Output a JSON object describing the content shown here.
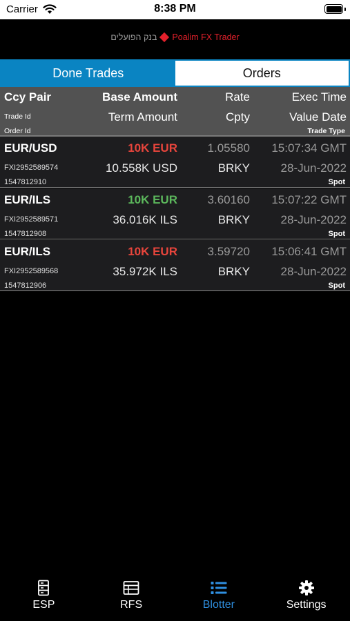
{
  "status_bar": {
    "carrier": "Carrier",
    "time": "8:38 PM"
  },
  "brand": {
    "hebrew_name": "בנק הפועלים",
    "app_name": "Poalim FX Trader",
    "accent_color": "#e3202b"
  },
  "tabs": {
    "done_trades": "Done Trades",
    "orders": "Orders",
    "active": "done_trades",
    "active_color": "#0a84c2"
  },
  "columns": {
    "row1": {
      "ccy_pair": "Ccy Pair",
      "base_amount": "Base Amount",
      "rate": "Rate",
      "exec_time": "Exec Time"
    },
    "row2": {
      "trade_id": "Trade Id",
      "term_amount": "Term Amount",
      "cpty": "Cpty",
      "value_date": "Value Date"
    },
    "row3": {
      "order_id": "Order Id",
      "trade_type": "Trade Type"
    }
  },
  "trades": [
    {
      "ccy_pair": "EUR/USD",
      "base_amount": "10K EUR",
      "direction": "sell",
      "rate": "1.05580",
      "exec_time": "15:07:34 GMT",
      "trade_id": "FXI2952589574",
      "term_amount": "10.558K USD",
      "cpty": "BRKY",
      "value_date": "28-Jun-2022",
      "order_id": "1547812910",
      "trade_type": "Spot"
    },
    {
      "ccy_pair": "EUR/ILS",
      "base_amount": "10K EUR",
      "direction": "buy",
      "rate": "3.60160",
      "exec_time": "15:07:22 GMT",
      "trade_id": "FXI2952589571",
      "term_amount": "36.016K ILS",
      "cpty": "BRKY",
      "value_date": "28-Jun-2022",
      "order_id": "1547812908",
      "trade_type": "Spot"
    },
    {
      "ccy_pair": "EUR/ILS",
      "base_amount": "10K EUR",
      "direction": "sell",
      "rate": "3.59720",
      "exec_time": "15:06:41 GMT",
      "trade_id": "FXI2952589568",
      "term_amount": "35.972K ILS",
      "cpty": "BRKY",
      "value_date": "28-Jun-2022",
      "order_id": "1547812906",
      "trade_type": "Spot"
    }
  ],
  "colors": {
    "sell": "#e8453c",
    "buy": "#5cb85c"
  },
  "tab_bar": {
    "items": [
      {
        "label": "ESP",
        "icon": "server-icon"
      },
      {
        "label": "RFS",
        "icon": "table-icon"
      },
      {
        "label": "Blotter",
        "icon": "list-icon"
      },
      {
        "label": "Settings",
        "icon": "gear-icon"
      }
    ],
    "active": "Blotter",
    "active_color": "#2f8fe0"
  }
}
